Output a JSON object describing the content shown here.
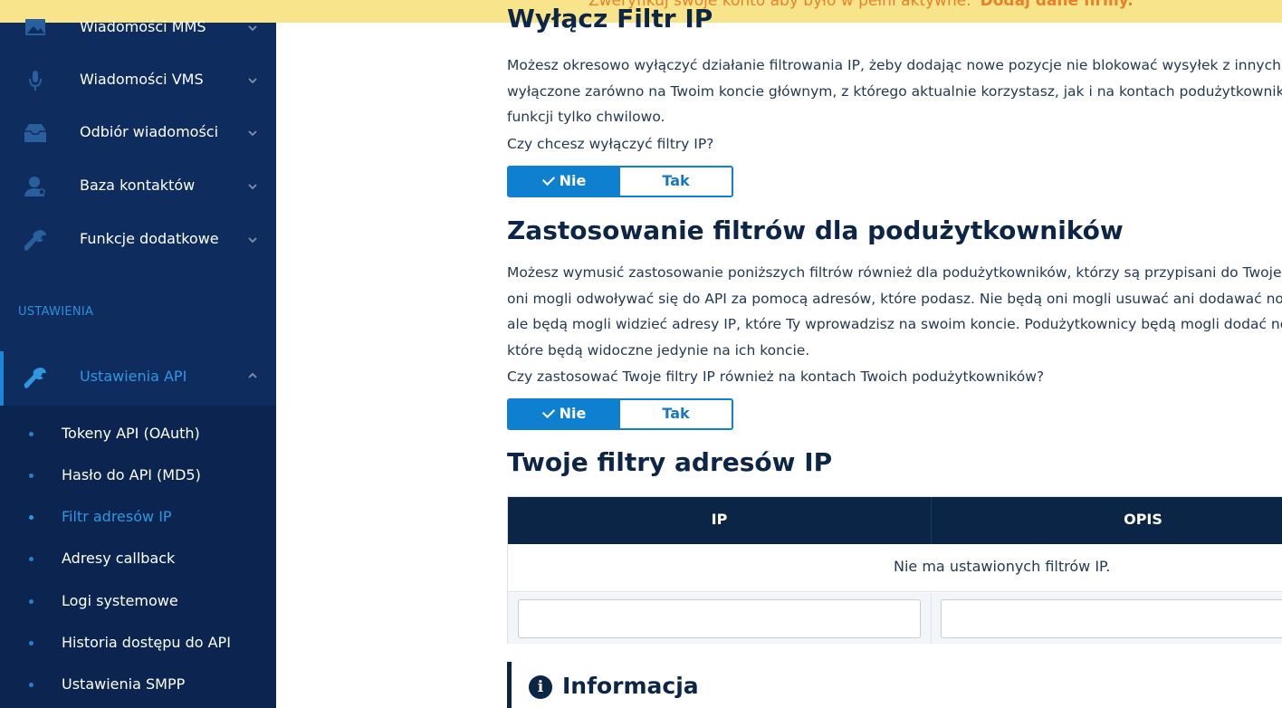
{
  "banner": {
    "text": "Zweryfikuj swoje konto aby było w pełni aktywne.",
    "link": "Dodaj dane firmy."
  },
  "sidebar": {
    "items": [
      {
        "label": "Wiadomości MMS",
        "icon": "image-icon"
      },
      {
        "label": "Wiadomości VMS",
        "icon": "microphone-icon"
      },
      {
        "label": "Odbiór wiadomości",
        "icon": "inbox-icon"
      },
      {
        "label": "Baza kontaktów",
        "icon": "contacts-icon"
      },
      {
        "label": "Funkcje dodatkowe",
        "icon": "wrench-icon"
      }
    ],
    "section_label": "USTAWIENIA",
    "active_item": {
      "label": "Ustawienia API",
      "icon": "wrench-icon"
    },
    "subitems": [
      {
        "label": "Tokeny API (OAuth)"
      },
      {
        "label": "Hasło do API (MD5)"
      },
      {
        "label": "Filtr adresów IP"
      },
      {
        "label": "Adresy callback"
      },
      {
        "label": "Logi systemowe"
      },
      {
        "label": "Historia dostępu do API"
      },
      {
        "label": "Ustawienia SMPP"
      }
    ]
  },
  "section1": {
    "title": "Wyłącz Filtr IP",
    "lines": [
      "Możesz okresowo wyłączyć działanie filtrowania IP, żeby dodając nowe pozycje nie blokować wysyłek z innych ad",
      "wyłączone zarówno na Twoim koncie głównym, z którego aktualnie korzystasz, jak i na kontach podużytkownikó",
      "funkcji tylko chwilowo."
    ],
    "question": "Czy chcesz wyłączyć filtry IP?",
    "toggle": {
      "no": "Nie",
      "yes": "Tak",
      "selected": "Nie"
    }
  },
  "section2": {
    "title": "Zastosowanie filtrów dla podużytkowników",
    "lines": [
      "Możesz wymusić zastosowanie poniższych filtrów również dla podużytkowników, którzy są przypisani do Twojeg",
      "oni mogli odwoływać się do API za pomocą adresów, które podasz. Nie będą oni mogli usuwać ani dodawać now",
      "ale będą mogli widzieć adresy IP, które Ty wprowadzisz na swoim koncie. Podużytkownicy będą mogli dodać nov",
      "które będą widoczne jedynie na ich koncie."
    ],
    "question": "Czy zastosować Twoje filtry IP również na kontach Twoich podużytkowników?",
    "toggle": {
      "no": "Nie",
      "yes": "Tak",
      "selected": "Nie"
    }
  },
  "section3": {
    "title": "Twoje filtry adresów IP",
    "table": {
      "headers": [
        "IP",
        "OPIS"
      ],
      "empty_message": "Nie ma ustawionych filtrów IP.",
      "ip_value": "",
      "description_value": ""
    }
  },
  "info": {
    "title": "Informacja"
  }
}
